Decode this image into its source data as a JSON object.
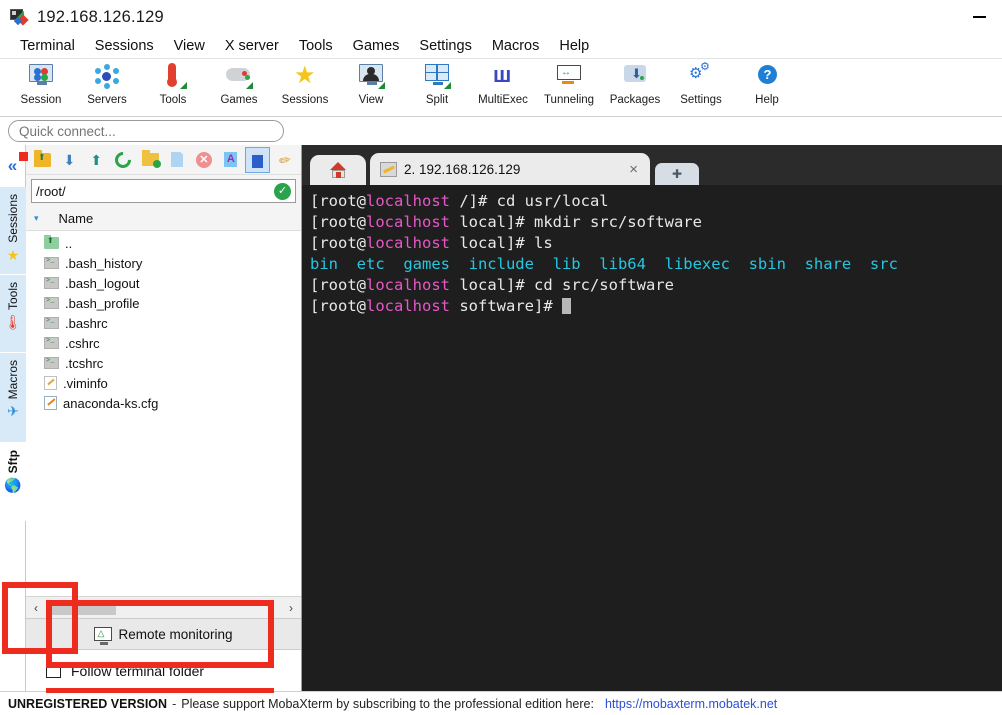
{
  "window": {
    "title": "192.168.126.129",
    "app_icon": "mobaxterm-icon",
    "minimize_label": "—"
  },
  "menubar": {
    "items": [
      {
        "label": "Terminal"
      },
      {
        "label": "Sessions"
      },
      {
        "label": "View"
      },
      {
        "label": "X server"
      },
      {
        "label": "Tools"
      },
      {
        "label": "Games"
      },
      {
        "label": "Settings"
      },
      {
        "label": "Macros"
      },
      {
        "label": "Help"
      }
    ]
  },
  "toolbar": {
    "items": [
      {
        "label": "Session",
        "icon": "session-monitor-icon"
      },
      {
        "label": "Servers",
        "icon": "servers-network-icon"
      },
      {
        "label": "Tools",
        "icon": "tools-thermometer-icon"
      },
      {
        "label": "Games",
        "icon": "games-gamepad-icon"
      },
      {
        "label": "Sessions",
        "icon": "sessions-star-icon"
      },
      {
        "label": "View",
        "icon": "view-person-monitor-icon"
      },
      {
        "label": "Split",
        "icon": "split-grid-icon"
      },
      {
        "label": "MultiExec",
        "icon": "multiexec-fork-icon"
      },
      {
        "label": "Tunneling",
        "icon": "tunneling-monitor-icon"
      },
      {
        "label": "Packages",
        "icon": "packages-download-icon"
      },
      {
        "label": "Settings",
        "icon": "settings-gears-icon"
      },
      {
        "label": "Help",
        "icon": "help-question-icon"
      }
    ]
  },
  "quick_connect": {
    "placeholder": "Quick connect...",
    "value": ""
  },
  "sidebar": {
    "collapse_icon": "double-chevron-left-icon",
    "tabs": [
      {
        "label": "Sessions",
        "icon": "star-icon",
        "active": false
      },
      {
        "label": "Tools",
        "icon": "thermometer-icon",
        "active": false
      },
      {
        "label": "Macros",
        "icon": "paper-plane-icon",
        "active": false
      },
      {
        "label": "Sftp",
        "icon": "globe-icon",
        "active": true
      }
    ]
  },
  "sftp": {
    "toolbar": [
      {
        "name": "folder-up-icon",
        "selected": false
      },
      {
        "name": "download-icon",
        "selected": false
      },
      {
        "name": "upload-icon",
        "selected": false
      },
      {
        "name": "refresh-icon",
        "selected": false
      },
      {
        "name": "new-folder-icon",
        "selected": false
      },
      {
        "name": "new-file-icon",
        "selected": false
      },
      {
        "name": "delete-icon",
        "selected": false
      },
      {
        "name": "text-mode-icon",
        "selected": false
      },
      {
        "name": "binary-mode-icon",
        "selected": true
      },
      {
        "name": "edit-pencil-icon",
        "selected": false
      }
    ],
    "path": "/root/",
    "path_status_icon": "check-circle-icon",
    "column_header": "Name",
    "sort_indicator": "▾",
    "files": [
      {
        "name": "..",
        "icon": "folder-up-icon"
      },
      {
        "name": ".bash_history",
        "icon": "shell-file-icon"
      },
      {
        "name": ".bash_logout",
        "icon": "shell-file-icon"
      },
      {
        "name": ".bash_profile",
        "icon": "shell-file-icon"
      },
      {
        "name": ".bashrc",
        "icon": "shell-file-icon"
      },
      {
        "name": ".cshrc",
        "icon": "shell-file-icon"
      },
      {
        "name": ".tcshrc",
        "icon": "shell-file-icon"
      },
      {
        "name": ".viminfo",
        "icon": "text-file-icon"
      },
      {
        "name": "anaconda-ks.cfg",
        "icon": "config-file-icon"
      }
    ],
    "scroll_left_icon": "‹",
    "scroll_right_icon": "›",
    "remote_monitoring_label": "Remote monitoring",
    "remote_monitoring_icon": "monitor-chart-icon",
    "follow_terminal_folder_label": "Follow terminal folder",
    "follow_terminal_folder_checked": false
  },
  "tabs": {
    "home_icon": "home-icon",
    "active": {
      "icon": "wrench-icon",
      "label": "2. 192.168.126.129",
      "close_icon": "×"
    },
    "new_tab_icon": "➕"
  },
  "terminal": {
    "lines": [
      {
        "segments": [
          {
            "t": "[root@",
            "c": "white"
          },
          {
            "t": "localhost",
            "c": "magenta"
          },
          {
            "t": " /]# cd usr/local",
            "c": "white"
          }
        ]
      },
      {
        "segments": [
          {
            "t": "[root@",
            "c": "white"
          },
          {
            "t": "localhost",
            "c": "magenta"
          },
          {
            "t": " local]# mkdir src/software",
            "c": "white"
          }
        ]
      },
      {
        "segments": [
          {
            "t": "[root@",
            "c": "white"
          },
          {
            "t": "localhost",
            "c": "magenta"
          },
          {
            "t": " local]# ls",
            "c": "white"
          }
        ]
      },
      {
        "segments": [
          {
            "t": "bin  etc  games  include  lib  lib64  libexec  sbin  share  src",
            "c": "cyan"
          }
        ]
      },
      {
        "segments": [
          {
            "t": "[root@",
            "c": "white"
          },
          {
            "t": "localhost",
            "c": "magenta"
          },
          {
            "t": " local]# cd src/software",
            "c": "white"
          }
        ]
      },
      {
        "segments": [
          {
            "t": "[root@",
            "c": "white"
          },
          {
            "t": "localhost",
            "c": "magenta"
          },
          {
            "t": " software]# ",
            "c": "white"
          },
          {
            "t": "",
            "c": "cursor"
          }
        ]
      }
    ],
    "background": "#1e1e1e",
    "foreground": "#e8e8e8",
    "accent_magenta": "#e857c8",
    "accent_cyan": "#27c6e0"
  },
  "statusbar": {
    "unregistered": "UNREGISTERED VERSION",
    "dash": "-",
    "message": "Please support MobaXterm by subscribing to the professional edition here:",
    "link": "https://mobaxterm.mobatek.net"
  },
  "annotations": {
    "color": "#ee2b1f",
    "boxes": [
      "sftp-sidebar-tab",
      "follow-terminal-folder"
    ]
  }
}
